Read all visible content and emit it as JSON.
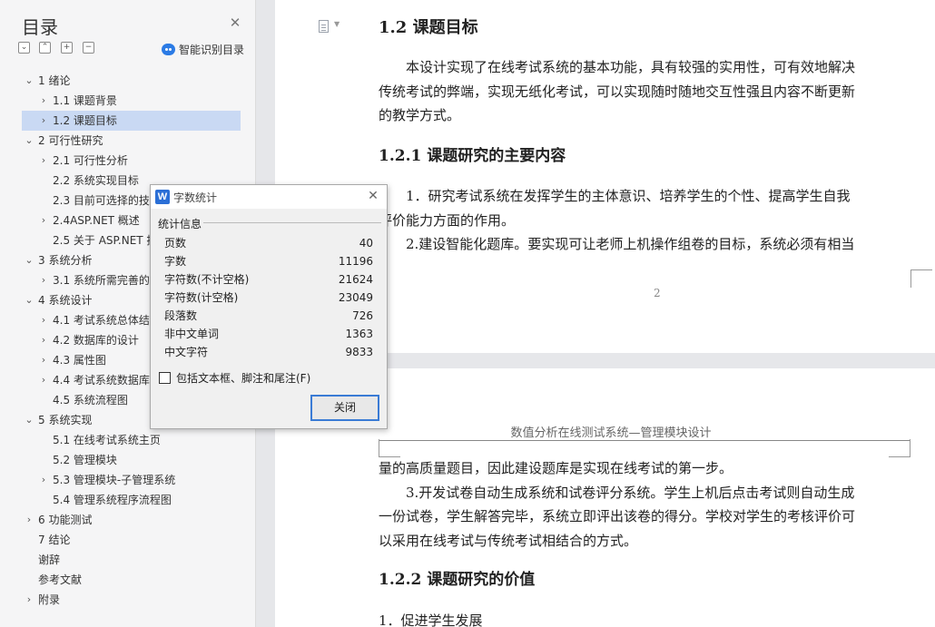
{
  "sidebar": {
    "title": "目录",
    "smart_toc_label": "智能识别目录",
    "items": [
      {
        "label": "1 绪论",
        "level": 0,
        "expand": "open"
      },
      {
        "label": "1.1 课题背景",
        "level": 1,
        "expand": "closed"
      },
      {
        "label": "1.2 课题目标",
        "level": 1,
        "expand": "closed",
        "selected": true
      },
      {
        "label": "2 可行性研究",
        "level": 0,
        "expand": "open"
      },
      {
        "label": "2.1 可行性分析",
        "level": 1,
        "expand": "closed"
      },
      {
        "label": "2.2 系统实现目标",
        "level": 1,
        "expand": "none"
      },
      {
        "label": "2.3 目前可选择的技术",
        "level": 1,
        "expand": "none"
      },
      {
        "label": "2.4ASP.NET 概述",
        "level": 1,
        "expand": "closed"
      },
      {
        "label": "2.5 关于 ASP.NET 技术",
        "level": 1,
        "expand": "none"
      },
      {
        "label": "3 系统分析",
        "level": 0,
        "expand": "open"
      },
      {
        "label": "3.1 系统所需完善的功能",
        "level": 1,
        "expand": "closed"
      },
      {
        "label": "4 系统设计",
        "level": 0,
        "expand": "open"
      },
      {
        "label": "4.1 考试系统总体结构",
        "level": 1,
        "expand": "closed"
      },
      {
        "label": "4.2 数据库的设计",
        "level": 1,
        "expand": "closed"
      },
      {
        "label": "4.3 属性图",
        "level": 1,
        "expand": "closed"
      },
      {
        "label": "4.4 考试系统数据库设计",
        "level": 1,
        "expand": "closed"
      },
      {
        "label": "4.5 系统流程图",
        "level": 1,
        "expand": "none"
      },
      {
        "label": "5 系统实现",
        "level": 0,
        "expand": "open"
      },
      {
        "label": "5.1 在线考试系统主页",
        "level": 1,
        "expand": "none"
      },
      {
        "label": "5.2 管理模块",
        "level": 1,
        "expand": "none"
      },
      {
        "label": "5.3 管理模块-子管理系统",
        "level": 1,
        "expand": "closed"
      },
      {
        "label": "5.4 管理系统程序流程图",
        "level": 1,
        "expand": "none"
      },
      {
        "label": "6 功能测试",
        "level": 0,
        "expand": "closed"
      },
      {
        "label": "7 结论",
        "level": 0,
        "expand": "none"
      },
      {
        "label": "谢辞",
        "level": 0,
        "expand": "none"
      },
      {
        "label": "参考文献",
        "level": 0,
        "expand": "none"
      },
      {
        "label": "附录",
        "level": 0,
        "expand": "closed"
      }
    ]
  },
  "page1": {
    "h_1_2": "1.2 课题目标",
    "p1_lines": [
      "　　本设计实现了在线考试系统的基本功能，具有较强的实用性，可有效地解决",
      "传统考试的弊端，实现无纸化考试，可以实现随时随地交互性强且内容不断更新",
      "的教学方式。"
    ],
    "h_1_2_1": "1.2.1 课题研究的主要内容",
    "p2_lines": [
      "　　1．研究考试系统在发挥学生的主体意识、培养学生的个性、提高学生自我",
      "评价能力方面的作用。",
      "　　2.建设智能化题库。要实现可让老师上机操作组卷的目标，系统必须有相当"
    ],
    "page_number": "2"
  },
  "page2": {
    "header": "数值分析在线测试系统—管理模块设计",
    "p_lines": [
      "量的高质量题目，因此建设题库是实现在线考试的第一步。",
      "　　3.开发试卷自动生成系统和试卷评分系统。学生上机后点击考试则自动生成",
      "一份试卷，学生解答完毕，系统立即评出该卷的得分。学校对学生的考核评价可",
      "以采用在线考试与传统考试相结合的方式。"
    ],
    "h_1_2_2": "1.2.2 课题研究的价值",
    "last_line": "1．促进学生发展"
  },
  "dialog": {
    "title": "字数统计",
    "logo": "W",
    "group_label": "统计信息",
    "stats": [
      {
        "label": "页数",
        "value": "40"
      },
      {
        "label": "字数",
        "value": "11196"
      },
      {
        "label": "字符数(不计空格)",
        "value": "21624"
      },
      {
        "label": "字符数(计空格)",
        "value": "23049"
      },
      {
        "label": "段落数",
        "value": "726"
      },
      {
        "label": "非中文单词",
        "value": "1363"
      },
      {
        "label": "中文字符",
        "value": "9833"
      }
    ],
    "checkbox_label": "包括文本框、脚注和尾注(F)",
    "close_button": "关闭"
  }
}
